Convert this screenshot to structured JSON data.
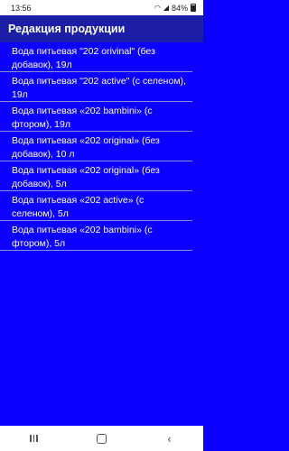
{
  "status_bar": {
    "time": "13:56",
    "battery": "84%",
    "icons": [
      "wifi-icon",
      "signal-icon",
      "battery-icon"
    ]
  },
  "app_bar": {
    "title": "Редакция продукции"
  },
  "products": [
    "Вода питьевая \"202 orivinal\" (без добавок), 19л",
    "Вода питьевая \"202 active\" (с селеном), 19л",
    "Вода питьевая «202 bambini» (с фтором), 19л",
    "Вода питьевая «202 original» (без добавок), 10 л",
    "Вода питьевая «202 original» (без добавок), 5л",
    "Вода питьевая «202 active» (с селеном), 5л",
    "Вода питьевая «202 bambini» (с фтором), 5л"
  ],
  "colors": {
    "background": "#0b00ff",
    "app_bar": "#1c1ea5",
    "text": "#ffffff",
    "divider": "#8b8bd8"
  },
  "nav_bar": {
    "icons": [
      "recents-icon",
      "home-icon",
      "back-icon"
    ]
  }
}
